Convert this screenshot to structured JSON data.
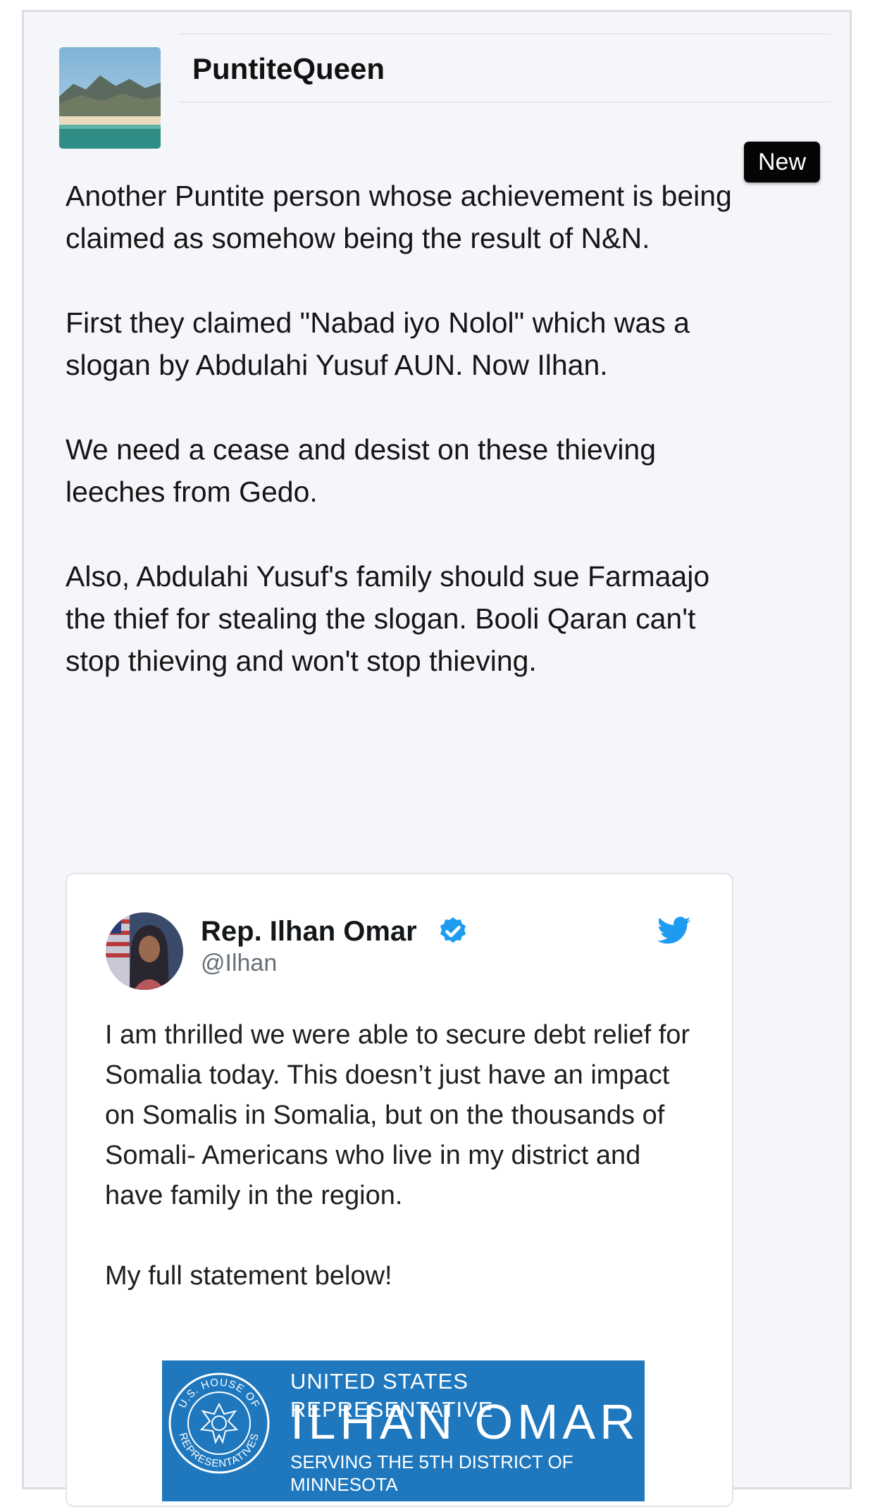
{
  "post": {
    "username": "PuntiteQueen",
    "badge": "New",
    "paragraphs": [
      "Another Puntite person whose achievement is being claimed as somehow being the result of N&N.",
      "First they claimed \"Nabad iyo Nolol\" which was a slogan by Abdulahi Yusuf AUN. Now Ilhan.",
      "We need a cease and desist on these thieving leeches from Gedo.",
      "Also, Abdulahi Yusuf's family should sue Farmaajo the thief for stealing the slogan. Booli Qaran can't stop thieving and won't stop thieving."
    ]
  },
  "tweet": {
    "name": "Rep. Ilhan Omar",
    "handle": "@Ilhan",
    "verified_icon": "verified-badge-icon",
    "platform_icon": "twitter-bird-icon",
    "paragraphs": [
      "I am thrilled we were able to secure debt relief for Somalia today. This doesn’t just have an impact on Somalis in Somalia, but on the thousands of Somali- Americans who live in my district and have family in the region.",
      "My full statement below!"
    ],
    "banner": {
      "line1": "UNITED STATES REPRESENTATIVE",
      "line2": "ILHAN OMAR",
      "line3": "SERVING THE 5TH DISTRICT OF MINNESOTA",
      "seal_text_top": "U.S. HOUSE OF",
      "seal_text_bottom": "REPRESENTATIVES"
    }
  },
  "colors": {
    "card_bg": "#f5f6fa",
    "badge_bg": "#050505",
    "twitter_blue": "#1d9bf0",
    "banner_blue": "#1f78be"
  }
}
